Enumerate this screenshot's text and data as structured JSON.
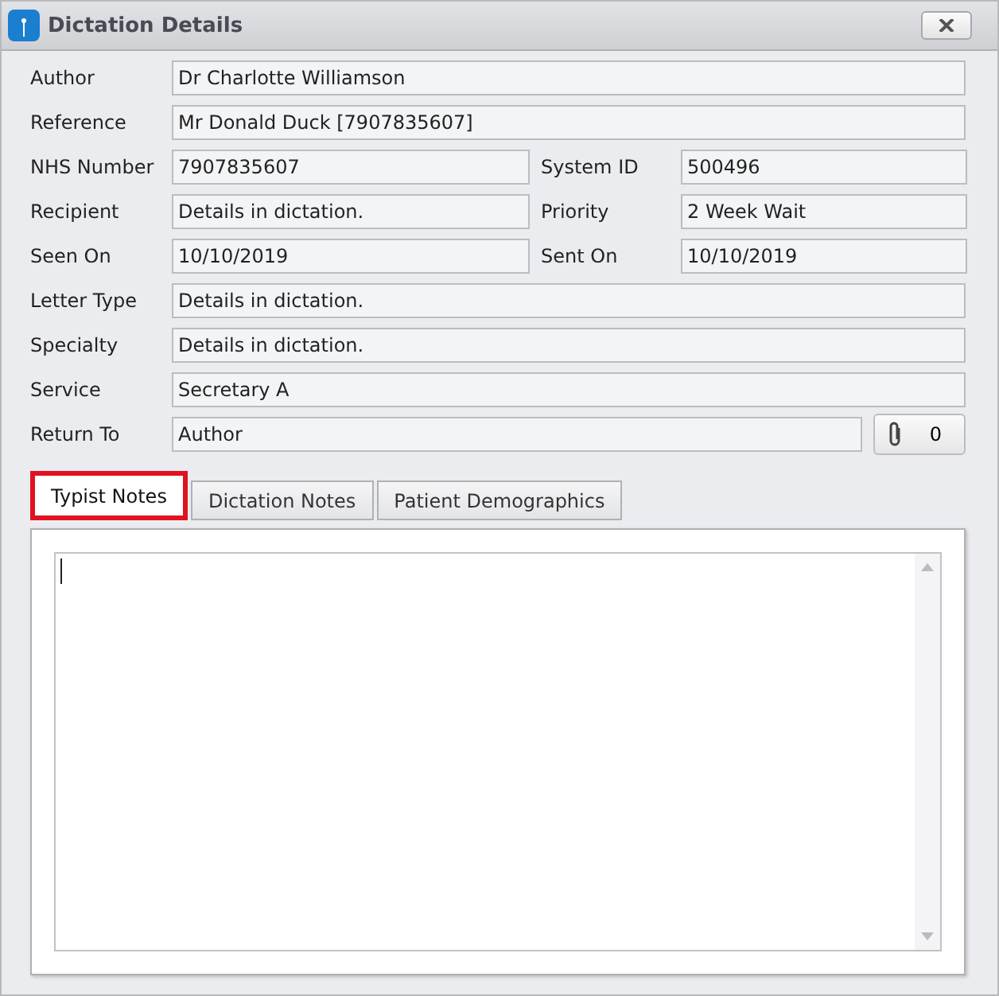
{
  "window": {
    "title": "Dictation Details"
  },
  "rows": [
    {
      "fields": [
        {
          "label": "Author",
          "value": "Dr Charlotte Williamson"
        }
      ]
    },
    {
      "fields": [
        {
          "label": "Reference",
          "value": "Mr Donald Duck [7907835607]"
        }
      ]
    },
    {
      "fields": [
        {
          "label": "NHS Number",
          "value": "7907835607"
        },
        {
          "label": "System ID",
          "value": "500496"
        }
      ]
    },
    {
      "fields": [
        {
          "label": "Recipient",
          "value": "Details in dictation."
        },
        {
          "label": "Priority",
          "value": "2 Week Wait"
        }
      ]
    },
    {
      "fields": [
        {
          "label": "Seen On",
          "value": "10/10/2019"
        },
        {
          "label": "Sent On",
          "value": "10/10/2019"
        }
      ]
    },
    {
      "fields": [
        {
          "label": "Letter Type",
          "value": "Details in dictation."
        }
      ]
    },
    {
      "fields": [
        {
          "label": "Specialty",
          "value": "Details in dictation."
        }
      ]
    },
    {
      "fields": [
        {
          "label": "Service",
          "value": "Secretary A"
        }
      ]
    },
    {
      "fields": [
        {
          "label": "Return To",
          "value": "Author"
        }
      ],
      "attachments": "0"
    }
  ],
  "tabs": [
    {
      "label": "Typist Notes",
      "selected": true,
      "highlighted": true
    },
    {
      "label": "Dictation Notes",
      "selected": false,
      "highlighted": false
    },
    {
      "label": "Patient Demographics",
      "selected": false,
      "highlighted": false
    }
  ]
}
